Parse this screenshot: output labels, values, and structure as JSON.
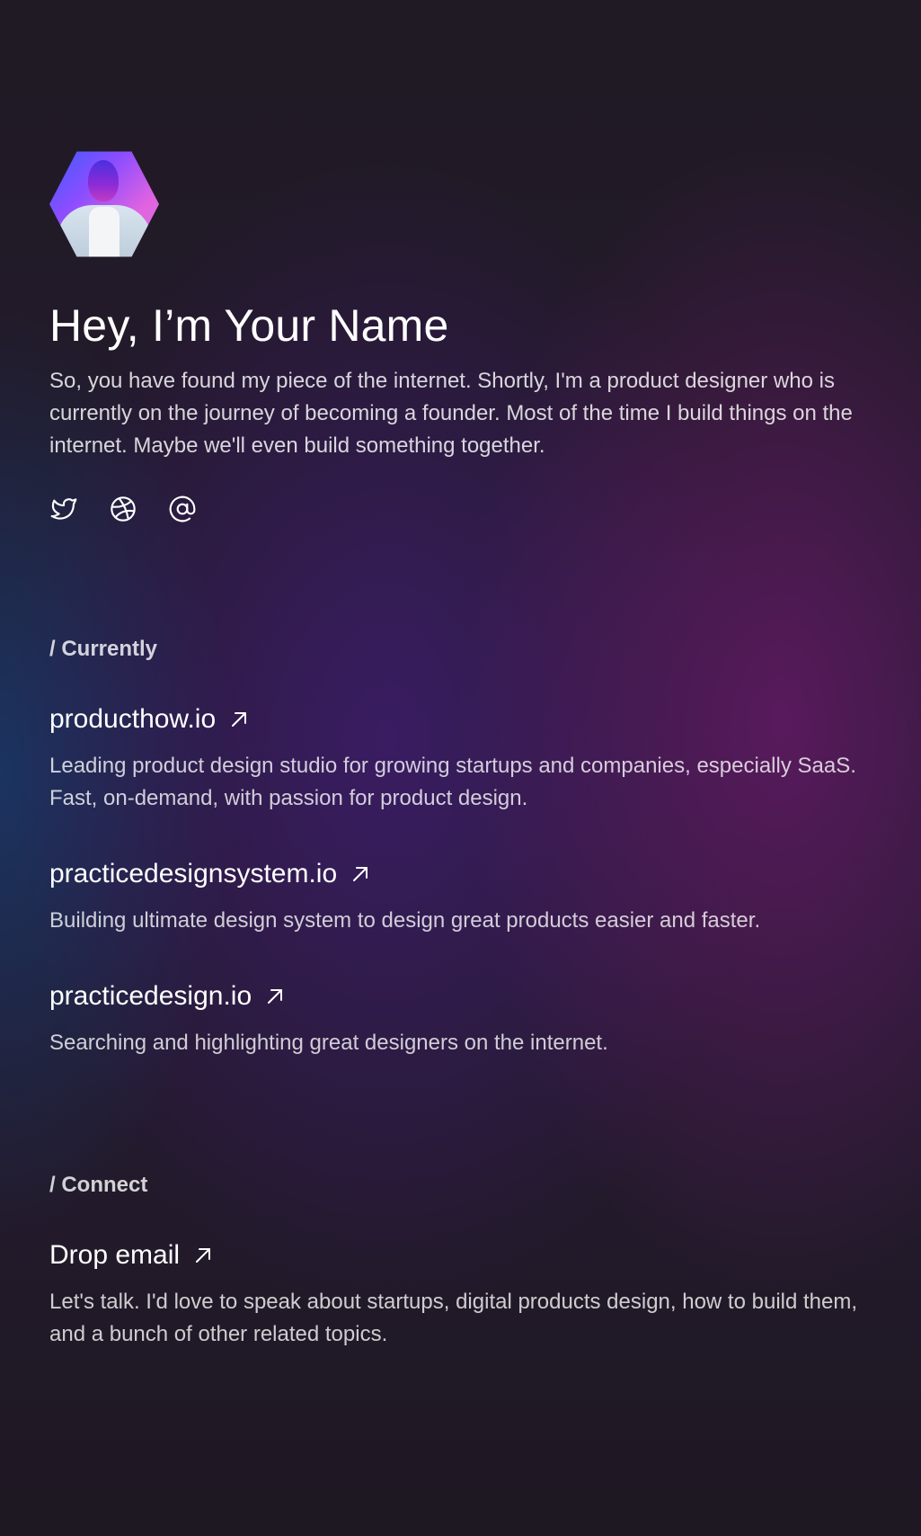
{
  "profile": {
    "avatar_alt": "Profile avatar",
    "title": "Hey, I’m Your Name",
    "intro": "So, you have found my piece of the internet. Shortly, I'm a product designer who is currently on the journey of becoming a founder. Most of the time I build things on the internet. Maybe we'll even build something together."
  },
  "socials": [
    {
      "icon": "twitter-icon"
    },
    {
      "icon": "dribbble-icon"
    },
    {
      "icon": "at-sign-icon"
    }
  ],
  "currently": {
    "label": "/ Currently",
    "items": [
      {
        "title": "producthow.io",
        "description": "Leading product design studio for growing startups and companies, especially SaaS. Fast, on-demand, with passion for product design."
      },
      {
        "title": "practicedesignsystem.io",
        "description": "Building ultimate design system to design great products easier and faster."
      },
      {
        "title": "practicedesign.io",
        "description": "Searching and highlighting great designers on the internet."
      }
    ]
  },
  "connect": {
    "label": "/ Connect",
    "items": [
      {
        "title": "Drop email",
        "description": "Let's talk. I'd love to speak about startups, digital products design, how to build them, and a bunch of other related topics."
      }
    ]
  },
  "colors": {
    "background": "#1e1822",
    "accent_purple": "#6e1a6e",
    "accent_blue": "#183a6c",
    "text": "#ffffff"
  }
}
